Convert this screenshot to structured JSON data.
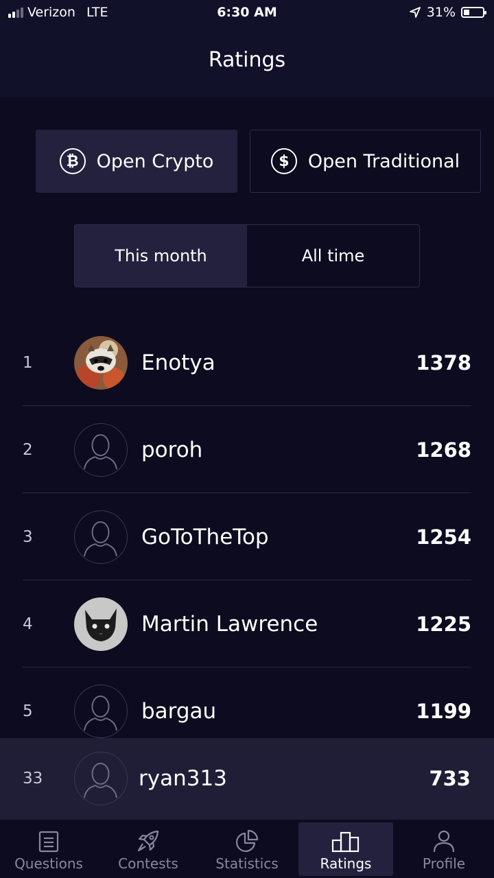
{
  "status_bar": {
    "carrier": "Verizon",
    "network": "LTE",
    "time": "6:30 AM",
    "battery": "31%",
    "battery_level": 0.31,
    "signal_bars": 2
  },
  "header": {
    "title": "Ratings"
  },
  "market_tabs": [
    {
      "label": "Open Crypto",
      "icon": "bitcoin-icon",
      "glyph": "₿",
      "active": true
    },
    {
      "label": "Open Traditional",
      "icon": "dollar-icon",
      "glyph": "$",
      "active": false
    }
  ],
  "period_tabs": [
    {
      "label": "This month",
      "active": true
    },
    {
      "label": "All time",
      "active": false
    }
  ],
  "leaderboard": [
    {
      "rank": "1",
      "name": "Enotya",
      "score": "1378",
      "avatar": "raccoon-photo"
    },
    {
      "rank": "2",
      "name": "poroh",
      "score": "1268",
      "avatar": "default-user"
    },
    {
      "rank": "3",
      "name": "GoToTheTop",
      "score": "1254",
      "avatar": "default-user"
    },
    {
      "rank": "4",
      "name": "Martin Lawrence",
      "score": "1225",
      "avatar": "cat-photo"
    },
    {
      "rank": "5",
      "name": "bargau",
      "score": "1199",
      "avatar": "default-user"
    }
  ],
  "current_user": {
    "rank": "33",
    "name": "ryan313",
    "score": "733",
    "avatar": "default-user"
  },
  "tab_bar": [
    {
      "label": "Questions",
      "icon": "questions-icon",
      "active": false
    },
    {
      "label": "Contests",
      "icon": "rocket-icon",
      "active": false
    },
    {
      "label": "Statistics",
      "icon": "statistics-icon",
      "active": false
    },
    {
      "label": "Ratings",
      "icon": "podium-icon",
      "active": true
    },
    {
      "label": "Profile",
      "icon": "profile-icon",
      "active": false
    }
  ],
  "colors": {
    "background": "#0d0b1f",
    "surface": "#12112a",
    "active_fill": "#23213d",
    "border": "#2f2d4a",
    "inactive_tab_text": "#8a88a0"
  }
}
